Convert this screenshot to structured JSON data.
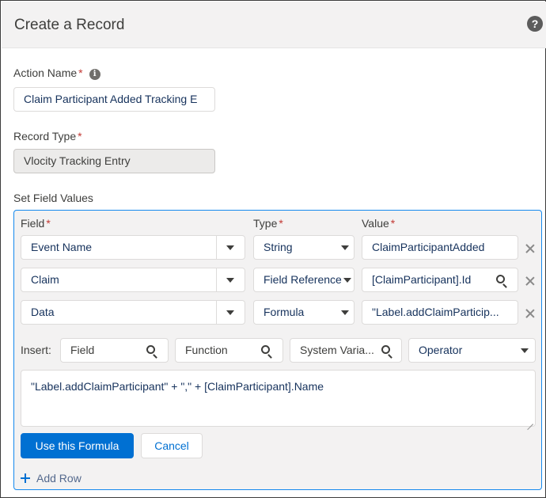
{
  "header": {
    "title": "Create a Record",
    "help_icon": "question-circle-icon",
    "help_glyph": "?"
  },
  "action_name": {
    "label": "Action Name",
    "required_mark": "*",
    "info_icon": "info-icon",
    "info_glyph": "i",
    "value": "Claim Participant Added Tracking E"
  },
  "record_type": {
    "label": "Record Type",
    "required_mark": "*",
    "value": "Vlocity Tracking Entry"
  },
  "set_field_values": {
    "label": "Set Field Values",
    "columns": {
      "field": "Field",
      "type": "Type",
      "value": "Value",
      "required_mark": "*"
    },
    "rows": [
      {
        "field": "Event Name",
        "type": "String",
        "value": "ClaimParticipantAdded"
      },
      {
        "field": "Claim",
        "type": "Field Reference",
        "value": "[ClaimParticipant].Id"
      },
      {
        "field": "Data",
        "type": "Formula",
        "value": "\"Label.addClaimParticip..."
      }
    ],
    "insert": {
      "label": "Insert:",
      "field_placeholder": "Field",
      "function_placeholder": "Function",
      "system_variable_placeholder": "System Varia...",
      "operator_value": "Operator"
    },
    "formula_text": "\"Label.addClaimParticipant\" + \",\" + [ClaimParticipant].Name",
    "use_formula_label": "Use this Formula",
    "cancel_label": "Cancel",
    "add_row_label": "Add Row"
  },
  "colors": {
    "brand": "#0070d2",
    "panel_border": "#1589ee",
    "required": "#c23934"
  }
}
